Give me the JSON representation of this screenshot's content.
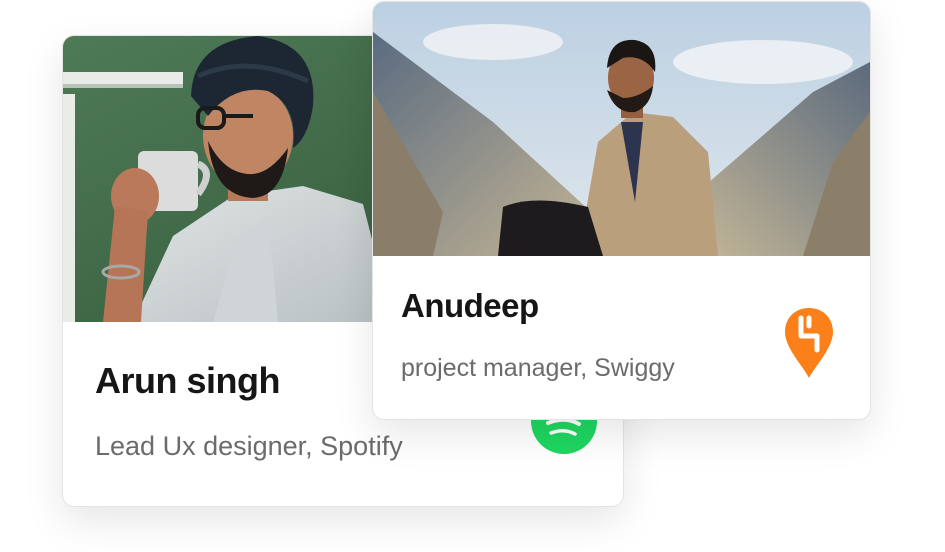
{
  "cards": [
    {
      "name": "Arun singh",
      "role": "Lead Ux designer, Spotify",
      "company_logo": "spotify-icon",
      "logo_color": "#1ED760",
      "photo": "man-turban-drinking-coffee-photo"
    },
    {
      "name": "Anudeep",
      "role": "project manager, Swiggy",
      "company_logo": "swiggy-icon",
      "logo_color": "#FC8019",
      "photo": "man-trench-coat-sitting-on-roof-photo"
    }
  ]
}
